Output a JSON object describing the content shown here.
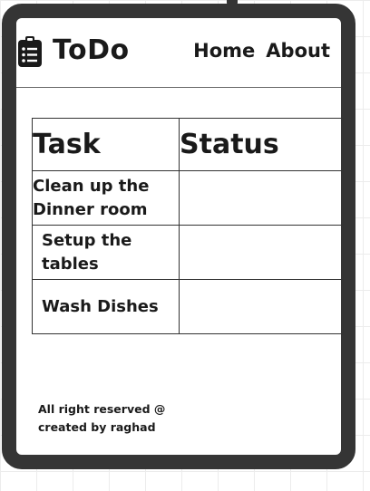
{
  "header": {
    "app_title": "ToDo",
    "icon": "clipboard-list-icon",
    "nav": [
      {
        "label": "Home"
      },
      {
        "label": "About"
      }
    ]
  },
  "table": {
    "columns": [
      "Task",
      "Status"
    ],
    "rows": [
      {
        "task": "Clean up the Dinner room",
        "status": ""
      },
      {
        "task": "Setup the tables",
        "status": ""
      },
      {
        "task": "Wash Dishes",
        "status": ""
      }
    ]
  },
  "footer": {
    "line1": "All right reserved @",
    "line2": "created by raghad"
  },
  "colors": {
    "frame": "#353535",
    "text": "#1a1a1a"
  }
}
